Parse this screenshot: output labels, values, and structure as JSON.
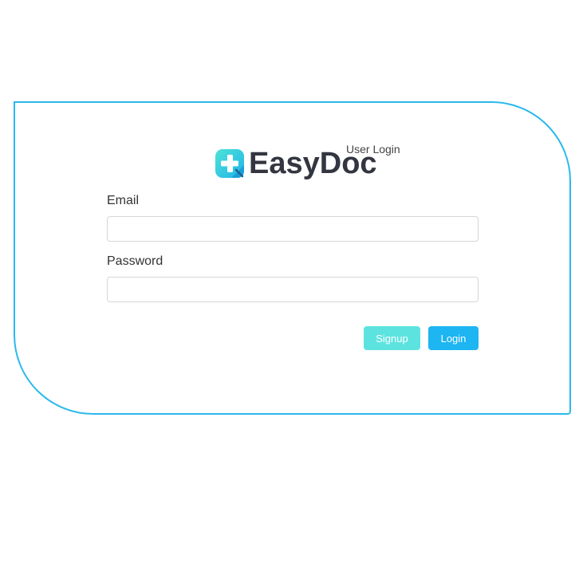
{
  "brand": {
    "name": "EasyDoc",
    "subtitle": "User Login",
    "icon": "medical-cross-icon",
    "colors": {
      "gradient_start": "#1fc7e0",
      "gradient_end": "#4fe3d6",
      "accent": "#2ab9ec"
    }
  },
  "form": {
    "email_label": "Email",
    "email_value": "",
    "email_placeholder": "",
    "password_label": "Password",
    "password_value": "",
    "password_placeholder": ""
  },
  "buttons": {
    "signup_label": "Signup",
    "login_label": "Login",
    "signup_color": "#5de3df",
    "login_color": "#1db5f2"
  }
}
